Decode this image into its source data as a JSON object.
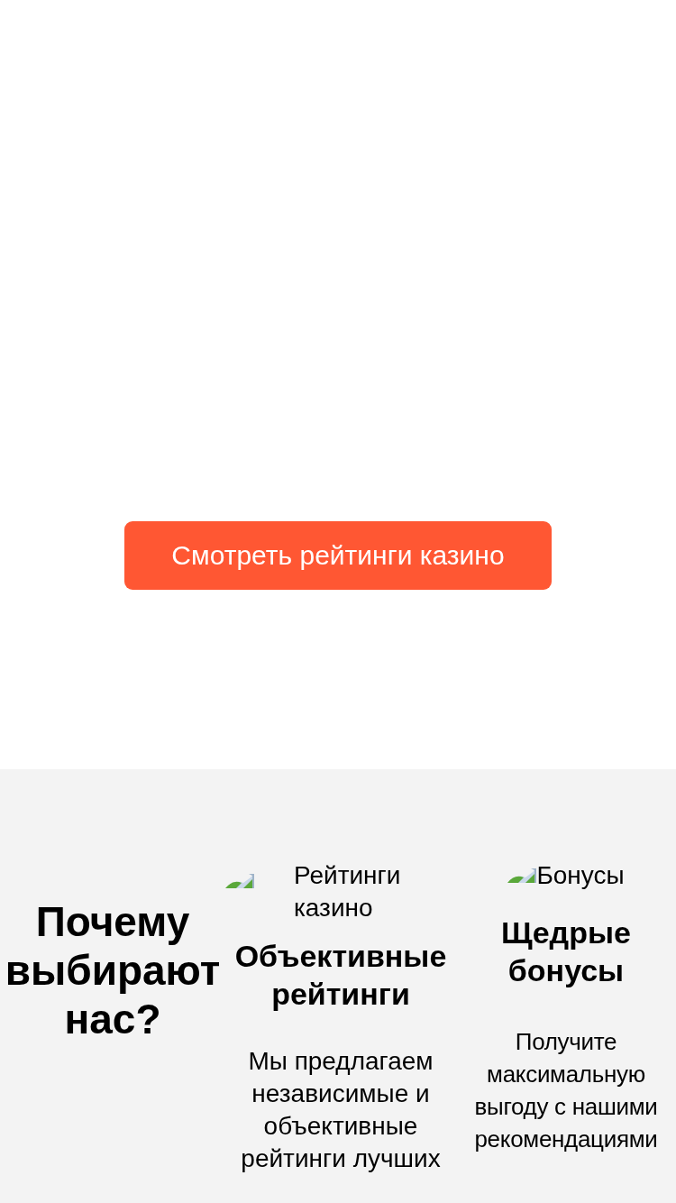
{
  "hero": {
    "button": "Смотреть рейтинги казино"
  },
  "features": {
    "heading": "Почему выбирают нас?",
    "items": [
      {
        "image_alt": "Рейтинги казино",
        "title": "Объективные рейтинги",
        "text": "Мы предлагаем независимые и объективные рейтинги лучших"
      },
      {
        "image_alt": "Бонусы",
        "title": "Щедрые бонусы",
        "text": "Получите максимальную выгоду с нашими рекомендациями"
      }
    ]
  }
}
